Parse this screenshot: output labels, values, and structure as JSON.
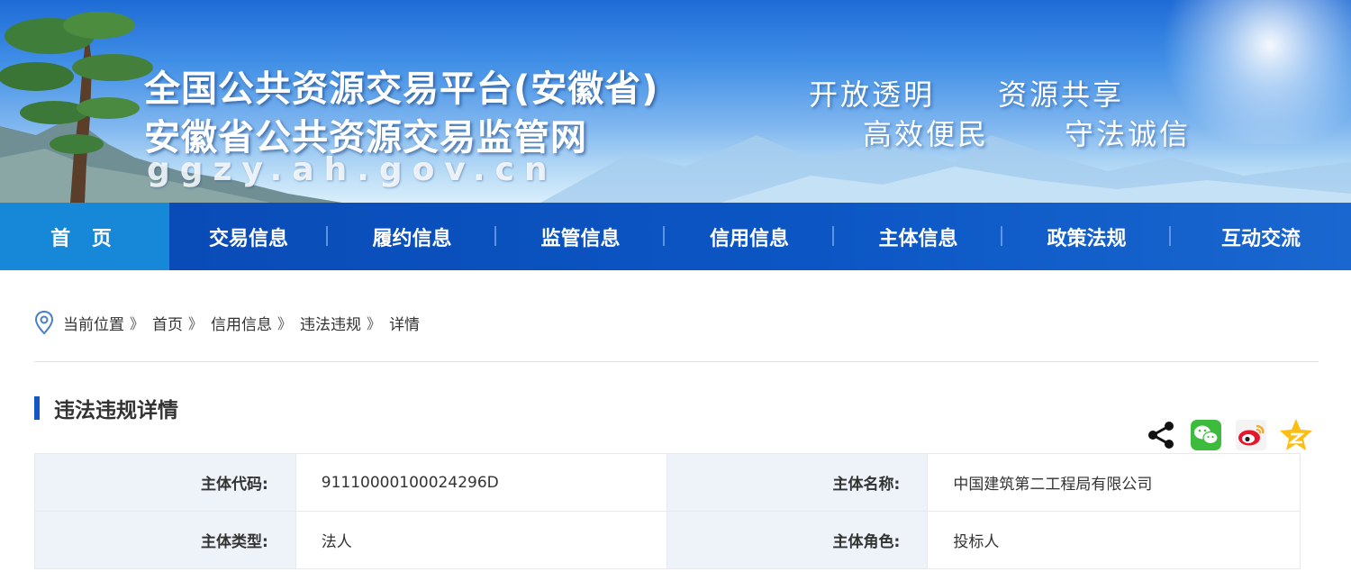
{
  "banner": {
    "title_line1": "全国公共资源交易平台(安徽省)",
    "title_line2": "安徽省公共资源交易监管网",
    "domain": "ggzy.ah.gov.cn",
    "slogans": [
      "开放透明",
      "资源共享",
      "高效便民",
      "守法诚信"
    ]
  },
  "nav": {
    "items": [
      "首 页",
      "交易信息",
      "履约信息",
      "监管信息",
      "信用信息",
      "主体信息",
      "政策法规",
      "互动交流"
    ],
    "active_index": 0
  },
  "breadcrumb": {
    "items": [
      "当前位置",
      "首页",
      "信用信息",
      "违法违规",
      "详情"
    ],
    "separator": "》"
  },
  "section": {
    "title": "违法违规详情"
  },
  "share": {
    "icons": [
      "share-icon",
      "wechat-icon",
      "weibo-icon",
      "qzone-icon"
    ]
  },
  "detail": {
    "rows": [
      [
        {
          "label": "主体代码:",
          "value": "91110000100024296D"
        },
        {
          "label": "主体名称:",
          "value": "中国建筑第二工程局有限公司"
        }
      ],
      [
        {
          "label": "主体类型:",
          "value": "法人"
        },
        {
          "label": "主体角色:",
          "value": "投标人"
        }
      ]
    ]
  },
  "colors": {
    "nav_bg": "#0b56c4",
    "nav_active": "#1787d8",
    "accent_bar": "#1356c4",
    "label_cell_bg": "#eef3f9"
  }
}
